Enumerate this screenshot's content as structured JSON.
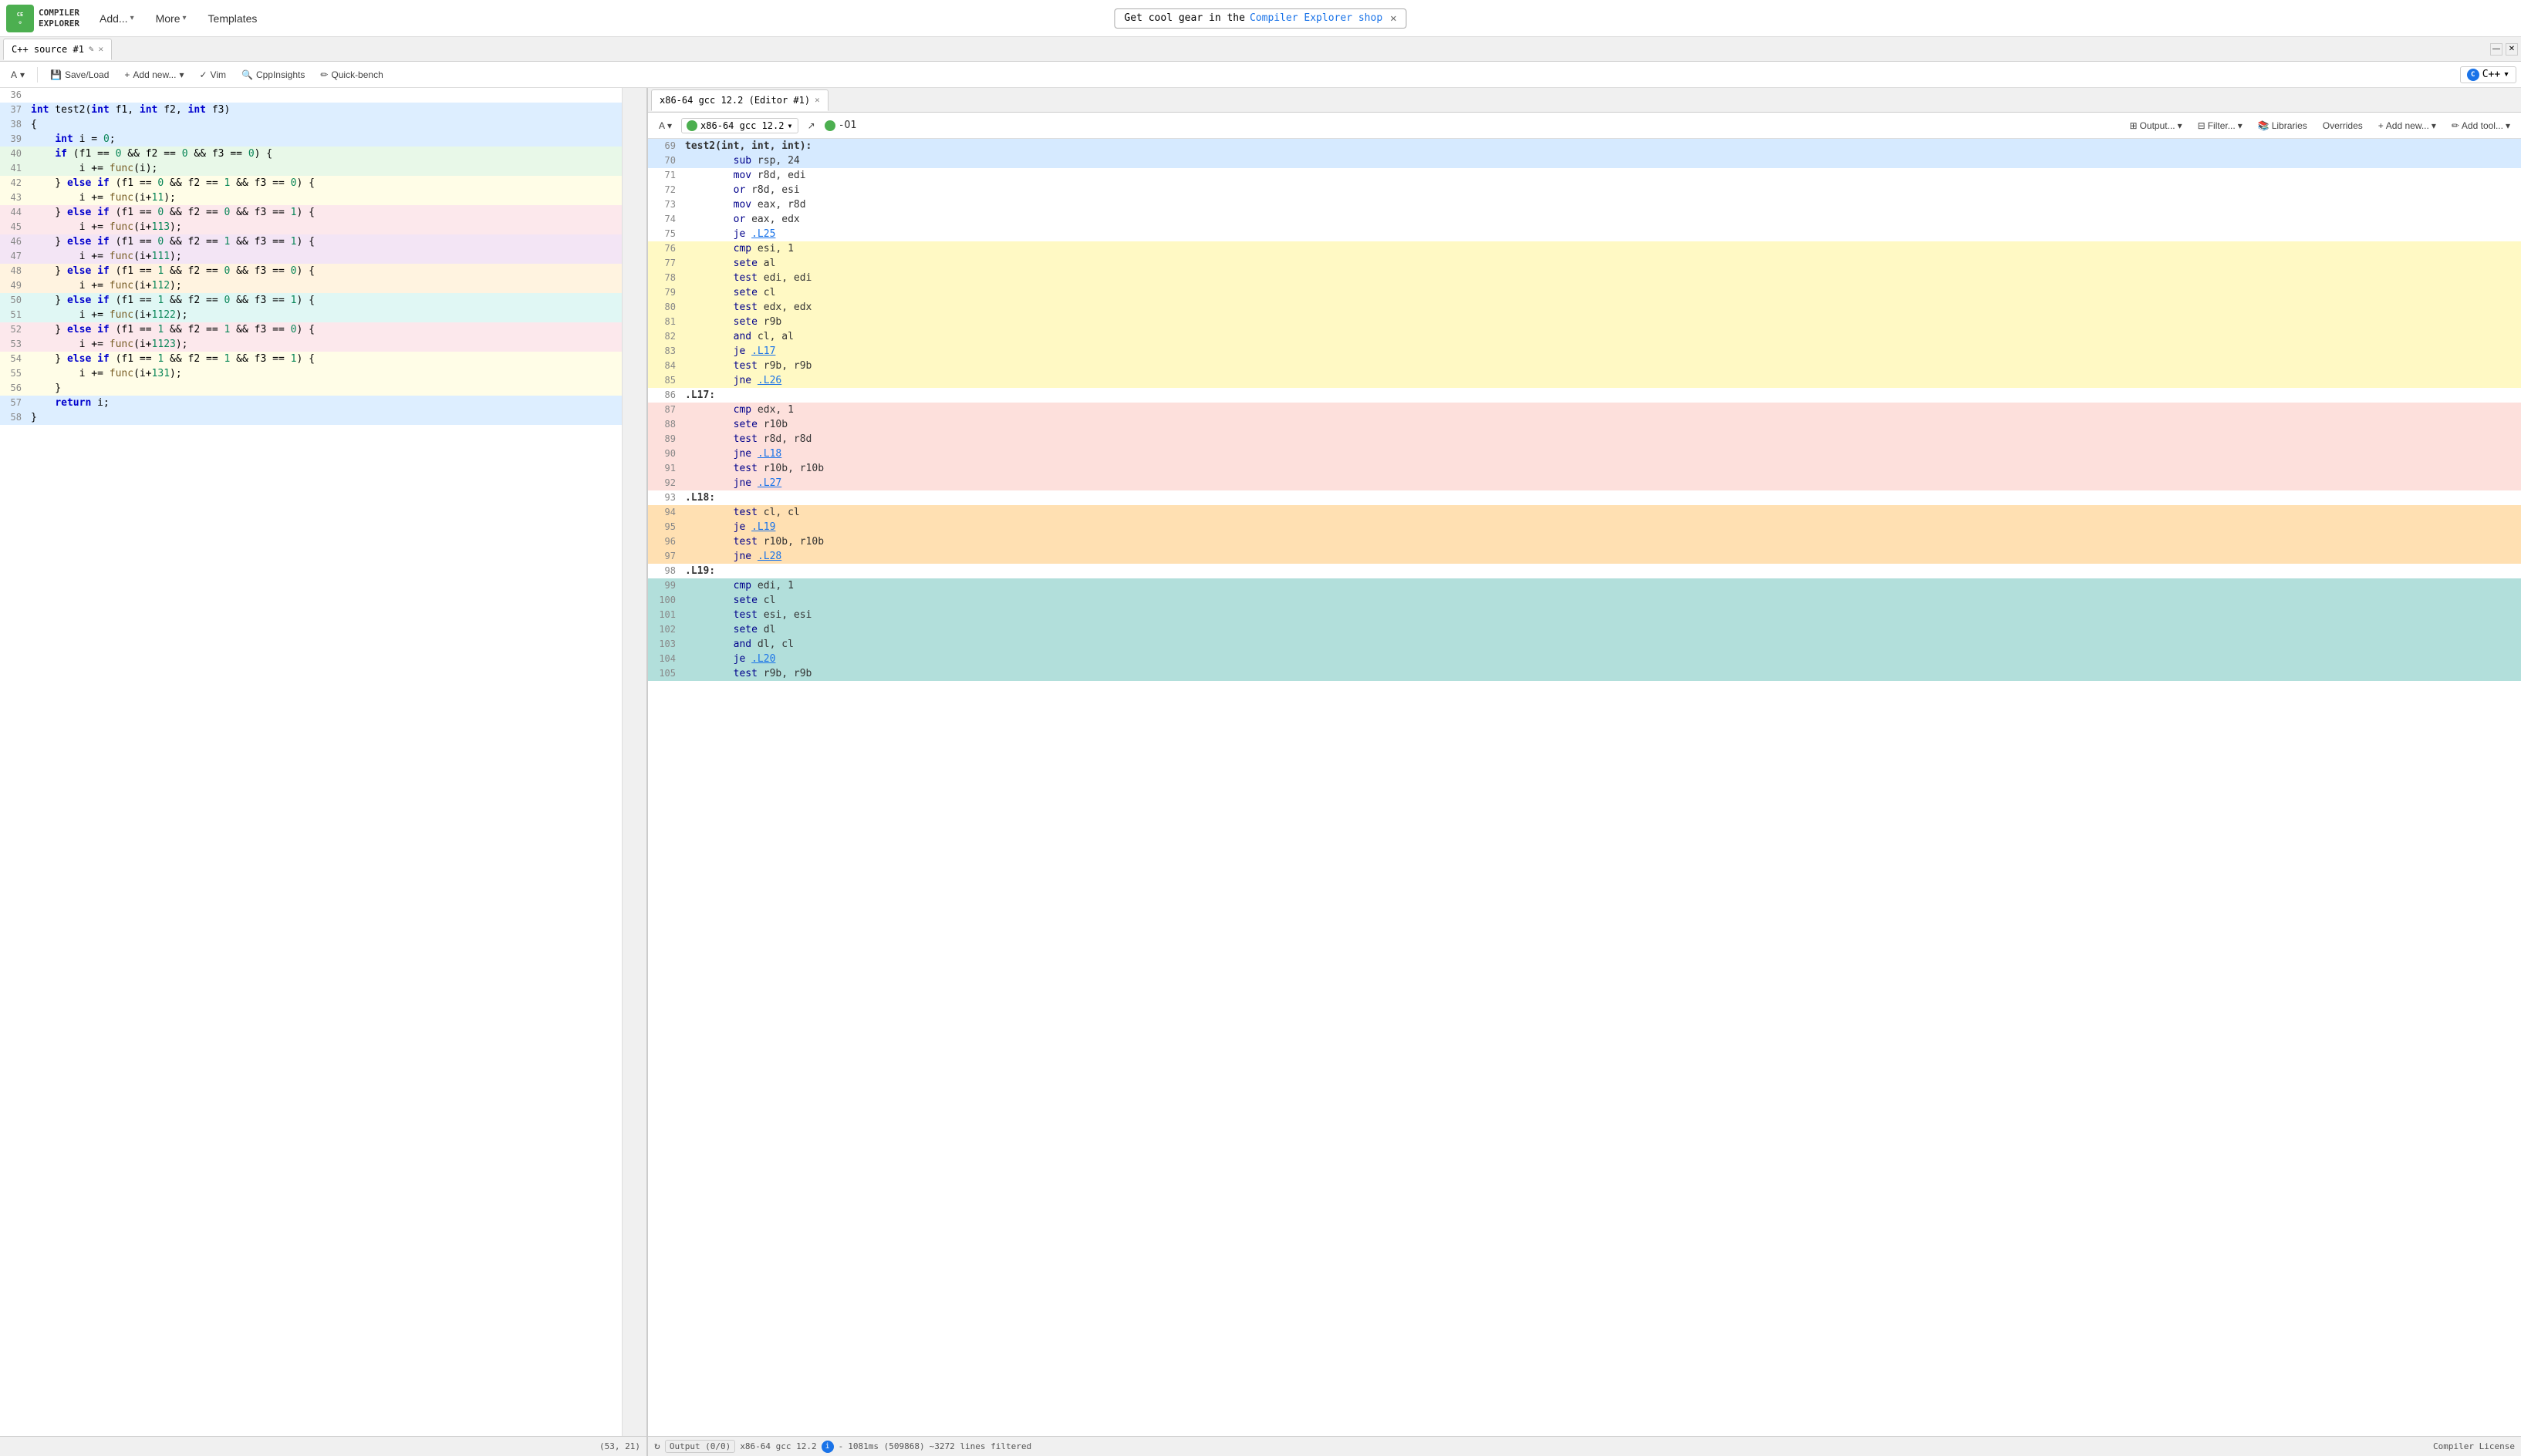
{
  "topnav": {
    "logo_line1": "COMPILER",
    "logo_line2": "EXPLORER",
    "add_btn": "Add...",
    "more_btn": "More",
    "templates_btn": "Templates",
    "promo_text": "Get cool gear in the ",
    "promo_link": "Compiler Explorer shop",
    "promo_close": "✕"
  },
  "editor_tab": {
    "title": "C++ source #1",
    "edit_icon": "✎",
    "close": "✕"
  },
  "asm_tab": {
    "title": "x86-64 gcc 12.2 (Editor #1)",
    "close": "✕"
  },
  "editor_toolbar": {
    "a_btn": "A",
    "save_load": "Save/Load",
    "add_new": "Add new...",
    "vim": "Vim",
    "cpp_insights": "CppInsights",
    "quick_bench": "Quick-bench",
    "lang": "C++"
  },
  "asm_toolbar": {
    "a_btn": "A",
    "compiler_name": "x86-64 gcc 12.2",
    "output_btn": "Output...",
    "filter_btn": "Filter...",
    "libraries": "Libraries",
    "overrides": "Overrides",
    "add_new": "Add new...",
    "add_tool": "Add tool...",
    "opt_flag": "-O1"
  },
  "code_lines": [
    {
      "num": "36",
      "text": "",
      "bg": "none"
    },
    {
      "num": "37",
      "text": "int test2(int f1, int f2, int f3)",
      "bg": "blue-light"
    },
    {
      "num": "38",
      "text": "{",
      "bg": "blue-light"
    },
    {
      "num": "39",
      "text": "    int i = 0;",
      "bg": "blue-light"
    },
    {
      "num": "40",
      "text": "    if (f1 == 0 && f2 == 0 && f3 == 0) {",
      "bg": "green-light"
    },
    {
      "num": "41",
      "text": "        i += func(i);",
      "bg": "green-light"
    },
    {
      "num": "42",
      "text": "    } else if (f1 == 0 && f2 == 1 && f3 == 0) {",
      "bg": "yellow-light"
    },
    {
      "num": "43",
      "text": "        i += func(i+11);",
      "bg": "yellow-light"
    },
    {
      "num": "44",
      "text": "    } else if (f1 == 0 && f2 == 0 && f3 == 1) {",
      "bg": "pink-light"
    },
    {
      "num": "45",
      "text": "        i += func(i+113);",
      "bg": "pink-light"
    },
    {
      "num": "46",
      "text": "    } else if (f1 == 0 && f2 == 1 && f3 == 1) {",
      "bg": "purple-light"
    },
    {
      "num": "47",
      "text": "        i += func(i+111);",
      "bg": "purple-light"
    },
    {
      "num": "48",
      "text": "    } else if (f1 == 1 && f2 == 0 && f3 == 0) {",
      "bg": "orange-light"
    },
    {
      "num": "49",
      "text": "        i += func(i+112);",
      "bg": "orange-light"
    },
    {
      "num": "50",
      "text": "    } else if (f1 == 1 && f2 == 0 && f3 == 1) {",
      "bg": "teal-light"
    },
    {
      "num": "51",
      "text": "        i += func(i+1122);",
      "bg": "teal-light"
    },
    {
      "num": "52",
      "text": "    } else if (f1 == 1 && f2 == 1 && f3 == 0) {",
      "bg": "pink-light"
    },
    {
      "num": "53",
      "text": "        i += func(i+1123);",
      "bg": "pink-light"
    },
    {
      "num": "54",
      "text": "    } else if (f1 == 1 && f2 == 1 && f3 == 1) {",
      "bg": "yellow-light"
    },
    {
      "num": "55",
      "text": "        i += func(i+131);",
      "bg": "yellow-light"
    },
    {
      "num": "56",
      "text": "    }",
      "bg": "yellow-light"
    },
    {
      "num": "57",
      "text": "    return i;",
      "bg": "blue-light"
    },
    {
      "num": "58",
      "text": "}",
      "bg": "blue-light"
    }
  ],
  "asm_lines": [
    {
      "num": "69",
      "label": "test2(int, int, int):",
      "bg": "blue"
    },
    {
      "num": "70",
      "indent": true,
      "instr": "sub",
      "ops": "rsp, 24",
      "bg": "blue"
    },
    {
      "num": "71",
      "indent": true,
      "instr": "mov",
      "ops": "r8d, edi",
      "bg": "none"
    },
    {
      "num": "72",
      "indent": true,
      "instr": "or",
      "ops": "r8d, esi",
      "bg": "none"
    },
    {
      "num": "73",
      "indent": true,
      "instr": "mov",
      "ops": "eax, r8d",
      "bg": "none"
    },
    {
      "num": "74",
      "indent": true,
      "instr": "or",
      "ops": "eax, edx",
      "bg": "none"
    },
    {
      "num": "75",
      "indent": true,
      "instr": "je",
      "ops": ".L25",
      "ops_link": true,
      "bg": "none"
    },
    {
      "num": "76",
      "indent": true,
      "instr": "cmp",
      "ops": "esi, 1",
      "bg": "yellow"
    },
    {
      "num": "77",
      "indent": true,
      "instr": "sete",
      "ops": "al",
      "bg": "yellow"
    },
    {
      "num": "78",
      "indent": true,
      "instr": "test",
      "ops": "edi, edi",
      "bg": "yellow"
    },
    {
      "num": "79",
      "indent": true,
      "instr": "sete",
      "ops": "cl",
      "bg": "yellow"
    },
    {
      "num": "80",
      "indent": true,
      "instr": "test",
      "ops": "edx, edx",
      "bg": "yellow"
    },
    {
      "num": "81",
      "indent": true,
      "instr": "sete",
      "ops": "r9b",
      "bg": "yellow"
    },
    {
      "num": "82",
      "indent": true,
      "instr": "and",
      "ops": "cl, al",
      "bg": "yellow"
    },
    {
      "num": "83",
      "indent": true,
      "instr": "je",
      "ops": ".L17",
      "ops_link": true,
      "bg": "yellow"
    },
    {
      "num": "84",
      "indent": true,
      "instr": "test",
      "ops": "r9b, r9b",
      "bg": "yellow"
    },
    {
      "num": "85",
      "indent": true,
      "instr": "jne",
      "ops": ".L26",
      "ops_link": true,
      "bg": "yellow"
    },
    {
      "num": "86",
      "label": ".L17:",
      "bg": "none"
    },
    {
      "num": "87",
      "indent": true,
      "instr": "cmp",
      "ops": "edx, 1",
      "bg": "pink"
    },
    {
      "num": "88",
      "indent": true,
      "instr": "sete",
      "ops": "r10b",
      "bg": "pink"
    },
    {
      "num": "89",
      "indent": true,
      "instr": "test",
      "ops": "r8d, r8d",
      "bg": "pink"
    },
    {
      "num": "90",
      "indent": true,
      "instr": "jne",
      "ops": ".L18",
      "ops_link": true,
      "bg": "pink"
    },
    {
      "num": "91",
      "indent": true,
      "instr": "test",
      "ops": "r10b, r10b",
      "bg": "pink"
    },
    {
      "num": "92",
      "indent": true,
      "instr": "jne",
      "ops": ".L27",
      "ops_link": true,
      "bg": "pink"
    },
    {
      "num": "93",
      "label": ".L18:",
      "bg": "none"
    },
    {
      "num": "94",
      "indent": true,
      "instr": "test",
      "ops": "cl, cl",
      "bg": "orange"
    },
    {
      "num": "95",
      "indent": true,
      "instr": "je",
      "ops": ".L19",
      "ops_link": true,
      "bg": "orange"
    },
    {
      "num": "96",
      "indent": true,
      "instr": "test",
      "ops": "r10b, r10b",
      "bg": "orange"
    },
    {
      "num": "97",
      "indent": true,
      "instr": "jne",
      "ops": ".L28",
      "ops_link": true,
      "bg": "orange"
    },
    {
      "num": "98",
      "label": ".L19:",
      "bg": "none"
    },
    {
      "num": "99",
      "indent": true,
      "instr": "cmp",
      "ops": "edi, 1",
      "bg": "teal"
    },
    {
      "num": "100",
      "indent": true,
      "instr": "sete",
      "ops": "cl",
      "bg": "teal"
    },
    {
      "num": "101",
      "indent": true,
      "instr": "test",
      "ops": "esi, esi",
      "bg": "teal"
    },
    {
      "num": "102",
      "indent": true,
      "instr": "sete",
      "ops": "dl",
      "bg": "teal"
    },
    {
      "num": "103",
      "indent": true,
      "instr": "and",
      "ops": "dl, cl",
      "bg": "teal"
    },
    {
      "num": "104",
      "indent": true,
      "instr": "je",
      "ops": ".L20",
      "ops_link": true,
      "bg": "teal"
    },
    {
      "num": "105",
      "indent": true,
      "instr": "test",
      "ops": "r9b, r9b",
      "bg": "teal"
    }
  ],
  "status": {
    "cursor": "(53, 21)",
    "output_label": "Output (0/0)",
    "compiler": "x86-64 gcc 12.2",
    "info": "i",
    "timing": "1081ms (509868)",
    "lines_filtered": "~3272 lines filtered",
    "compiler_license": "Compiler License"
  }
}
